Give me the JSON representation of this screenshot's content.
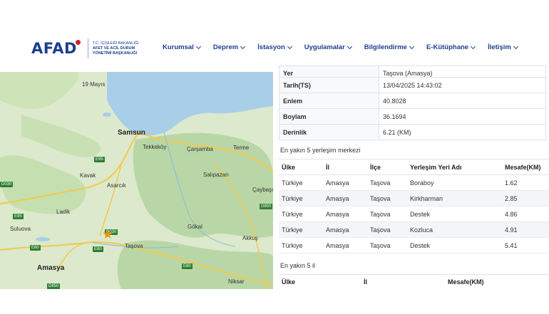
{
  "header": {
    "logo_text": "AFAD",
    "logo_sub": [
      "T.C. İÇİŞLERİ BAKANLIĞI",
      "AFET VE ACİL DURUM",
      "YÖNETİMİ BAŞKANLIĞI"
    ],
    "nav": [
      "Kurumsal",
      "Deprem",
      "İstasyon",
      "Uygulamalar",
      "Bilgilendirme",
      "E-Kütüphane",
      "İletişim"
    ]
  },
  "map": {
    "labels": {
      "mayis": "19 Mayıs",
      "samsun": "Samsun",
      "tekkekoy": "Tekkeköy",
      "carsamba": "Çarşamba",
      "terme": "Terme",
      "kavak": "Kavak",
      "asarcik": "Asarcık",
      "salipazari": "Salıpazarı",
      "caybasi": "Çaybaşı",
      "ladik": "Ladik",
      "suluova": "Suluova",
      "gokal": "Gökal",
      "tasova": "Taşova",
      "akkus": "Akkuş",
      "amasya": "Amasya",
      "niksar": "Niksar"
    },
    "roads": [
      "E95",
      "D030",
      "D850",
      "E95",
      "D030",
      "E80",
      "E80",
      "E80",
      "D850"
    ],
    "marker_icon": "star-icon",
    "colors": {
      "land": "#d8e8c8",
      "sea": "#a9cfe8",
      "forest": "#b9d7a6",
      "marker": "#f39200"
    }
  },
  "details": {
    "rows": [
      {
        "key": "Yer",
        "value": "Taşova (Amasya)"
      },
      {
        "key": "Tarih(TS)",
        "value": "13/04/2025 14:43:02"
      },
      {
        "key": "Enlem",
        "value": "40.8028"
      },
      {
        "key": "Boylam",
        "value": "36.1694"
      },
      {
        "key": "Derinlik",
        "value": "6.21 (KM)"
      }
    ]
  },
  "settlements": {
    "title": "En yakın 5 yerleşim merkezi",
    "columns": [
      "Ülke",
      "İl",
      "İlçe",
      "Yerleşim Yeri Adı",
      "Mesafe(KM)"
    ],
    "rows": [
      [
        "Türkiye",
        "Amasya",
        "Taşova",
        "Boraboy",
        "1.62"
      ],
      [
        "Türkiye",
        "Amasya",
        "Taşova",
        "Kirkharman",
        "2.85"
      ],
      [
        "Türkiye",
        "Amasya",
        "Taşova",
        "Destek",
        "4.86"
      ],
      [
        "Türkiye",
        "Amasya",
        "Taşova",
        "Kozluca",
        "4.91"
      ],
      [
        "Türkiye",
        "Amasya",
        "Taşova",
        "Destek",
        "5.41"
      ]
    ]
  },
  "provinces": {
    "title": "En yakın 5 il",
    "columns": [
      "Ülke",
      "İl",
      "Mesafe(KM)"
    ]
  }
}
